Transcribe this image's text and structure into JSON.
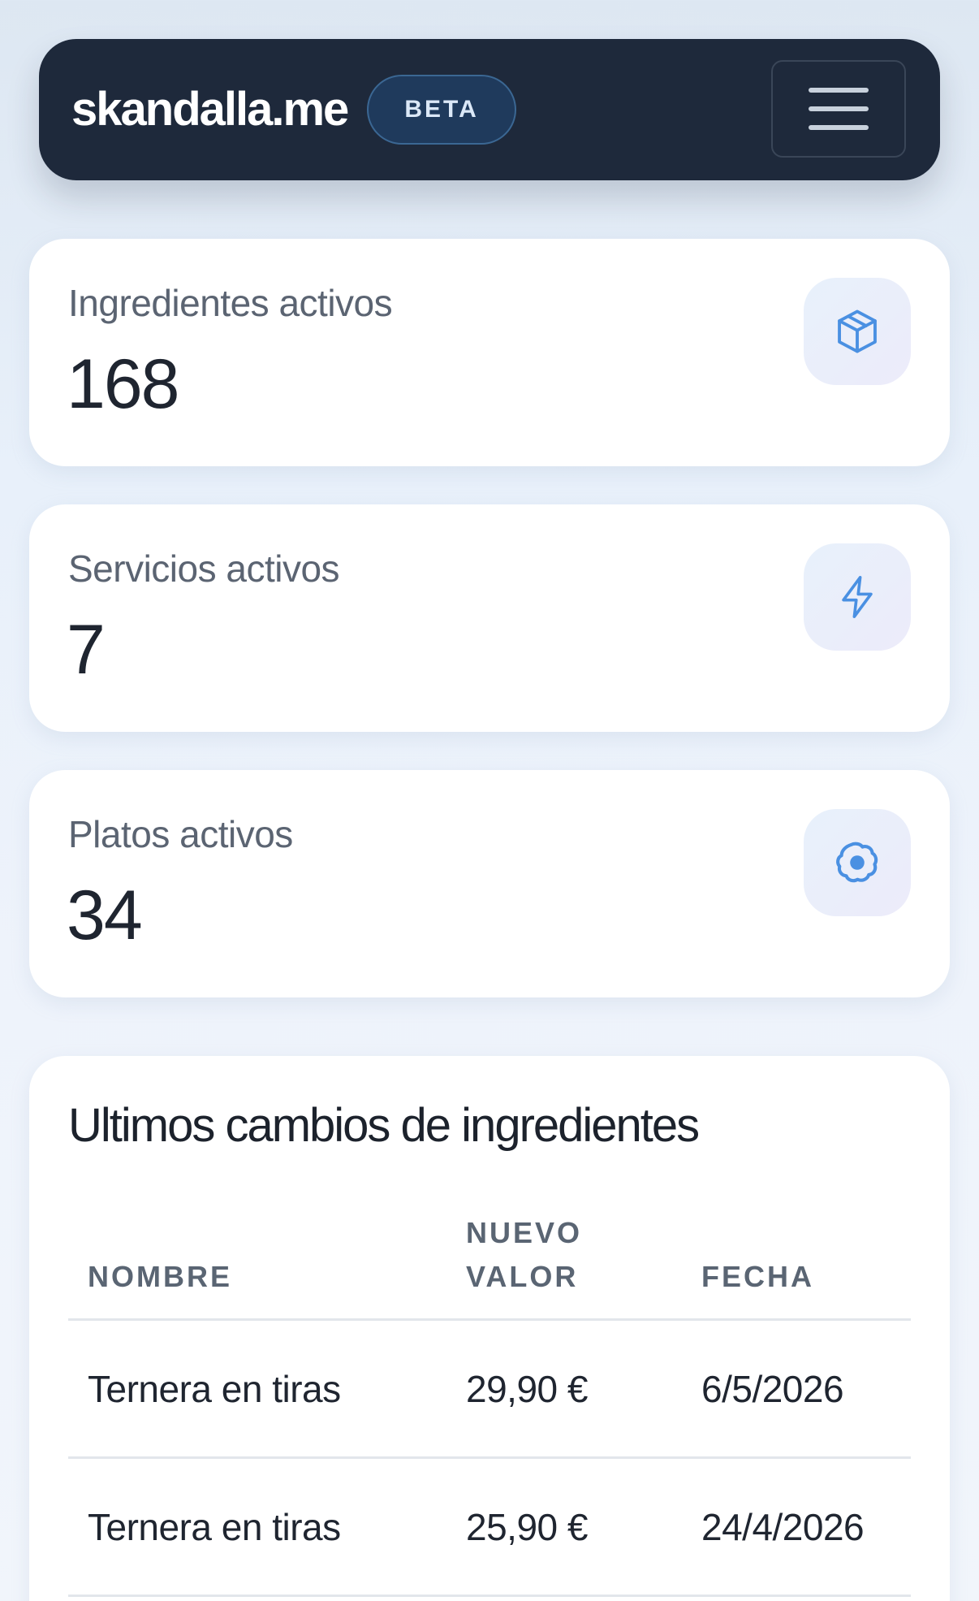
{
  "header": {
    "brand": "skandalla.me",
    "badge": "BETA",
    "menu_icon": "hamburger-icon"
  },
  "stats": [
    {
      "label": "Ingredientes activos",
      "value": "168",
      "icon": "box-icon"
    },
    {
      "label": "Servicios activos",
      "value": "7",
      "icon": "bolt-icon"
    },
    {
      "label": "Platos activos",
      "value": "34",
      "icon": "fried-egg-icon"
    }
  ],
  "changes": {
    "title": "Ultimos cambios de ingredientes",
    "columns": {
      "name": "NOMBRE",
      "value_line1": "NUEVO",
      "value_line2": "VALOR",
      "date": "FECHA"
    },
    "rows": [
      {
        "name": "Ternera en tiras",
        "value": "29,90 €",
        "date": "6/5/2026"
      },
      {
        "name": "Ternera en tiras",
        "value": "25,90 €",
        "date": "24/4/2026"
      }
    ]
  },
  "colors": {
    "header_bg": "#1e293b",
    "badge_bg": "#1f3a5c",
    "icon_blue": "#4a90e2"
  }
}
